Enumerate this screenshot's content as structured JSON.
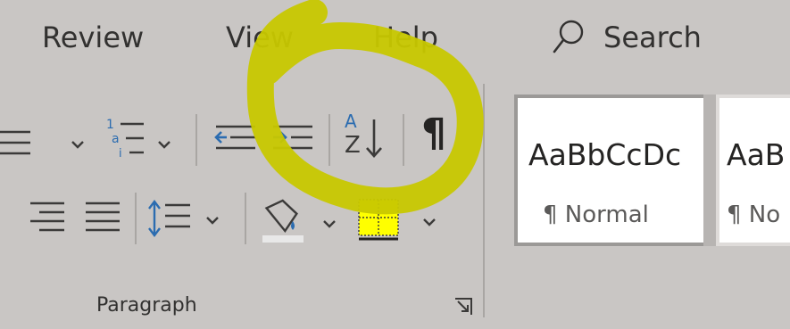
{
  "tabs": {
    "review": "Review",
    "view": "View",
    "help": "Help"
  },
  "search": {
    "label": "Search",
    "icon": "search-icon"
  },
  "paragraph": {
    "group_label": "Paragraph",
    "row1": [
      "bullets-icon",
      "numbering-icon",
      "decrease-indent-icon",
      "increase-indent-icon",
      "sort-icon",
      "show-formatting-marks-icon"
    ],
    "row2": [
      "align-right-icon",
      "justify-icon",
      "line-spacing-icon",
      "shading-icon",
      "borders-icon"
    ],
    "sort_letters": {
      "a": "A",
      "z": "Z"
    },
    "pilcrow": "¶",
    "launcher_icon": "dialog-launcher-icon"
  },
  "styles": {
    "items": [
      {
        "sample": "AaBbCcDc",
        "name": "¶ Normal"
      },
      {
        "sample": "AaB",
        "name": "¶ No"
      }
    ]
  },
  "colors": {
    "ribbon_bg": "#c9c6c4",
    "text": "#323130",
    "accent_blue": "#2b6cb0",
    "highlight": "#c8c800",
    "borders_fill": "#ffff00"
  }
}
